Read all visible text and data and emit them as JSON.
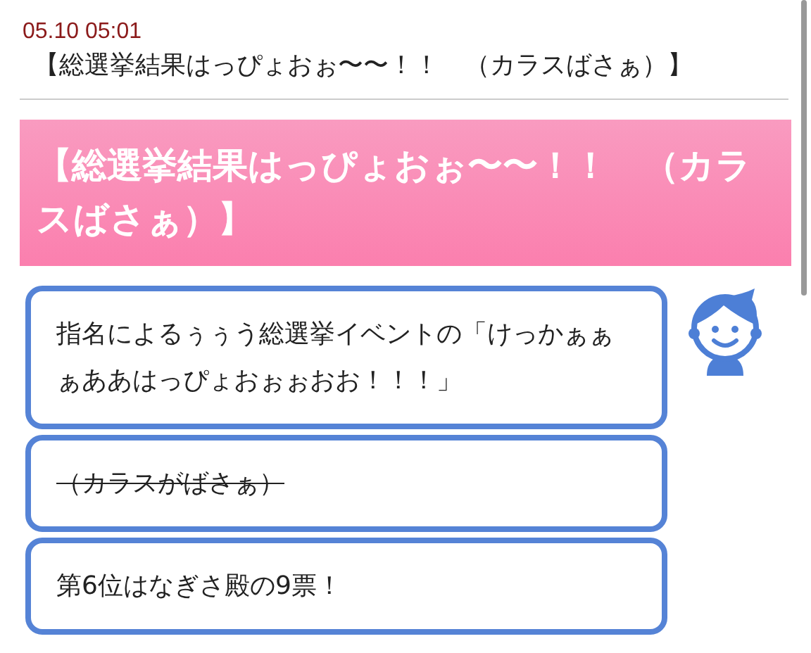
{
  "post": {
    "date": "05.10 05:01",
    "title": "【総選挙結果はっぴょおぉ〜〜！！　（カラスばさぁ）】"
  },
  "banner": {
    "title": "【総選挙結果はっぴょおぉ〜〜！！　（カラスばさぁ）】"
  },
  "messages": [
    {
      "text": "指名によるぅぅう総選挙イベントの「けっかぁぁぁああはっぴょおぉぉおお！！！」",
      "struck": false
    },
    {
      "text": "（カラスがばさぁ）",
      "struck": true
    },
    {
      "text": "第6位はなぎさ殿の9票！",
      "struck": false
    }
  ]
}
